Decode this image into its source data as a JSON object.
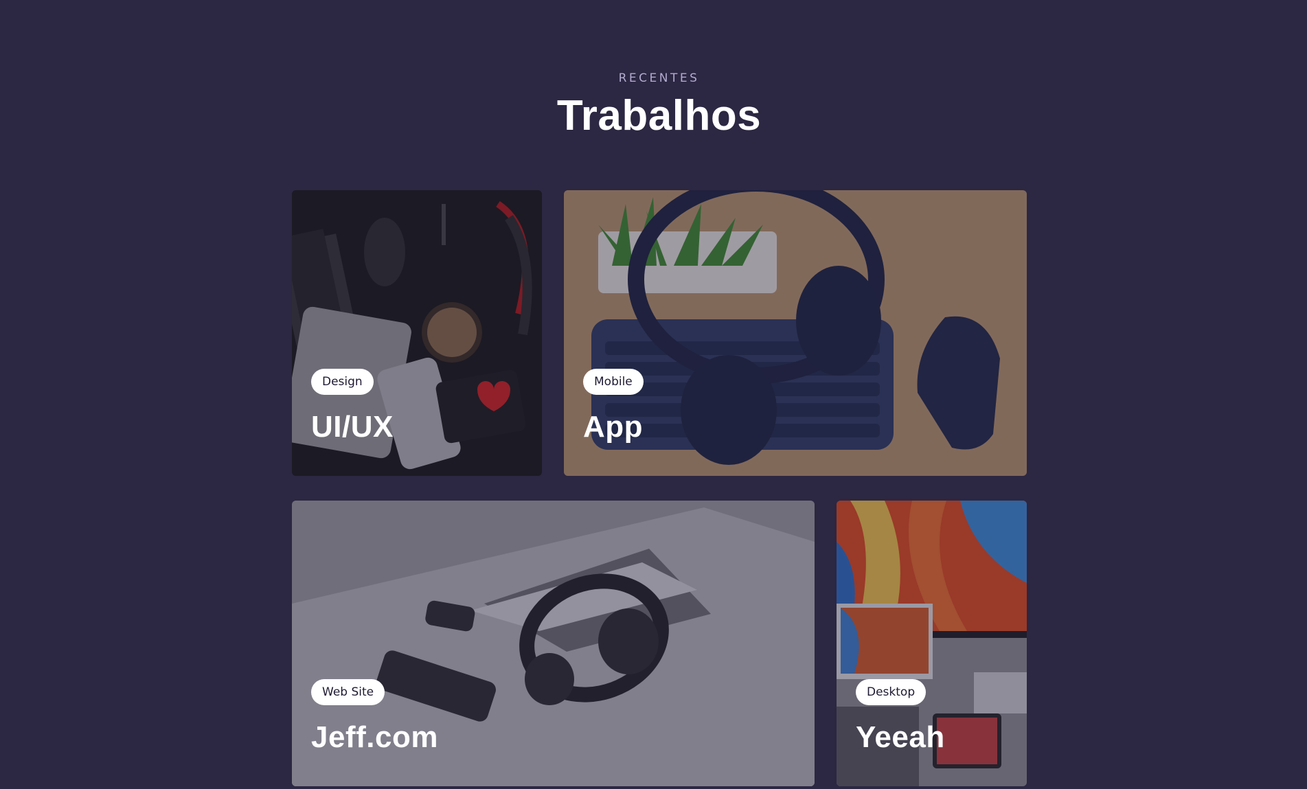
{
  "header": {
    "eyebrow": "RECENTES",
    "title": "Trabalhos"
  },
  "cards": [
    {
      "tag": "Design",
      "title": "UI/UX"
    },
    {
      "tag": "Mobile",
      "title": "App"
    },
    {
      "tag": "Web Site",
      "title": "Jeff.com"
    },
    {
      "tag": "Desktop",
      "title": "Yeeah"
    }
  ],
  "colors": {
    "background": "#2c2742",
    "eyebrow": "#b3abcf",
    "title": "#ffffff",
    "tag_bg": "#ffffff",
    "tag_text": "#1f1a33"
  }
}
